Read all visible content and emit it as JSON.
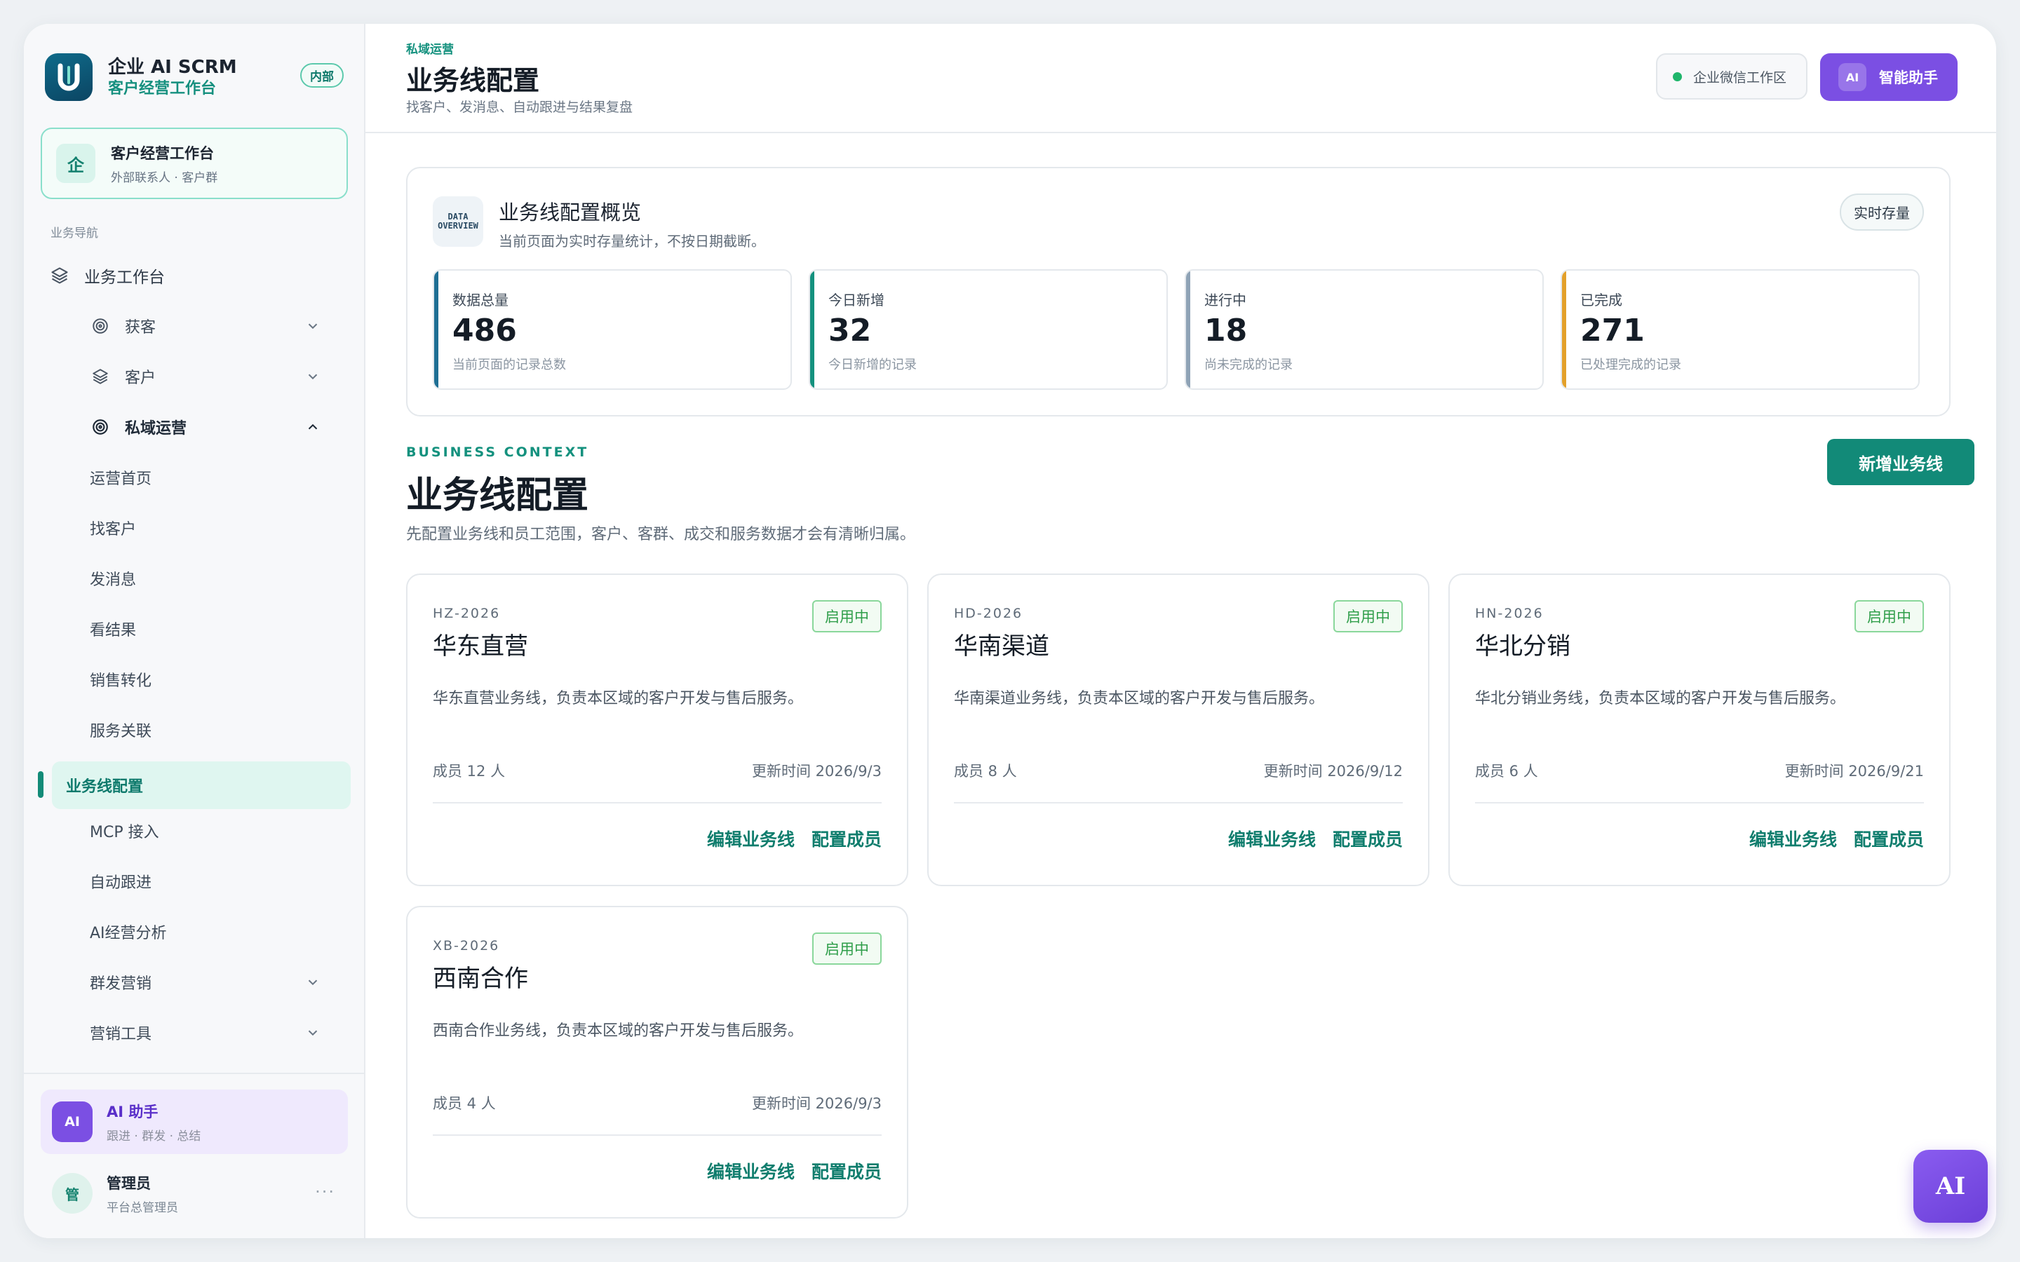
{
  "brand": {
    "title": "企业 AI SCRM",
    "subtitle": "客户经营工作台",
    "tag": "内部"
  },
  "workspace": {
    "icon_char": "企",
    "title": "客户经营工作台",
    "subtitle": "外部联系人 · 客户群"
  },
  "nav": {
    "heading": "业务导航",
    "top_item": "业务工作台",
    "groups": [
      {
        "label": "获客",
        "expanded": false
      },
      {
        "label": "客户",
        "expanded": false
      },
      {
        "label": "私域运营",
        "expanded": true
      }
    ],
    "private_items": [
      "运营首页",
      "找客户",
      "发消息",
      "看结果",
      "销售转化",
      "服务关联",
      "业务线配置",
      "MCP 接入",
      "自动跟进",
      "AI经营分析"
    ],
    "active_item": "业务线配置",
    "tail_groups": [
      "群发营销",
      "营销工具"
    ]
  },
  "assistant_card": {
    "badge": "AI",
    "title": "AI 助手",
    "subtitle": "跟进 · 群发 · 总结"
  },
  "user": {
    "avatar_char": "管",
    "name": "管理员",
    "role": "平台总管理员",
    "more": "···"
  },
  "header": {
    "breadcrumb": "私域运营",
    "title": "业务线配置",
    "subtitle": "找客户、发消息、自动跟进与结果复盘",
    "workspace_pill": "企业微信工作区",
    "assistant_button": {
      "badge": "AI",
      "label": "智能助手"
    }
  },
  "overview": {
    "icon_text_1": "DATA",
    "icon_text_2": "OVERVIEW",
    "title": "业务线配置概览",
    "subtitle": "当前页面为实时存量统计，不按日期截断。",
    "badge": "实时存量",
    "stats": [
      {
        "label": "数据总量",
        "value": "486",
        "note": "当前页面的记录总数",
        "color": "#1f6f94"
      },
      {
        "label": "今日新增",
        "value": "32",
        "note": "今日新增的记录",
        "color": "#14917e"
      },
      {
        "label": "进行中",
        "value": "18",
        "note": "尚未完成的记录",
        "color": "#8fa3b6"
      },
      {
        "label": "已完成",
        "value": "271",
        "note": "已处理完成的记录",
        "color": "#e3a02a"
      }
    ]
  },
  "section": {
    "eyebrow": "BUSINESS CONTEXT",
    "title": "业务线配置",
    "subtitle": "先配置业务线和员工范围，客户、客群、成交和服务数据才会有清晰归属。",
    "add_button": "新增业务线"
  },
  "business_lines": [
    {
      "code": "HZ-2026",
      "name": "华东直营",
      "status": "启用中",
      "desc": "华东直营业务线，负责本区域的客户开发与售后服务。",
      "members": "成员 12 人",
      "updated": "更新时间 2026/9/3",
      "edit": "编辑业务线",
      "config": "配置成员"
    },
    {
      "code": "HD-2026",
      "name": "华南渠道",
      "status": "启用中",
      "desc": "华南渠道业务线，负责本区域的客户开发与售后服务。",
      "members": "成员 8 人",
      "updated": "更新时间 2026/9/12",
      "edit": "编辑业务线",
      "config": "配置成员"
    },
    {
      "code": "HN-2026",
      "name": "华北分销",
      "status": "启用中",
      "desc": "华北分销业务线，负责本区域的客户开发与售后服务。",
      "members": "成员 6 人",
      "updated": "更新时间 2026/9/21",
      "edit": "编辑业务线",
      "config": "配置成员"
    },
    {
      "code": "XB-2026",
      "name": "西南合作",
      "status": "启用中",
      "desc": "西南合作业务线，负责本区域的客户开发与售后服务。",
      "members": "成员 4 人",
      "updated": "更新时间 2026/9/3",
      "edit": "编辑业务线",
      "config": "配置成员"
    }
  ],
  "floating_ai": "AI",
  "colors": {
    "accent": "#128a78",
    "purple": "#7b4fe3",
    "status_green": "#2f9e4a"
  }
}
